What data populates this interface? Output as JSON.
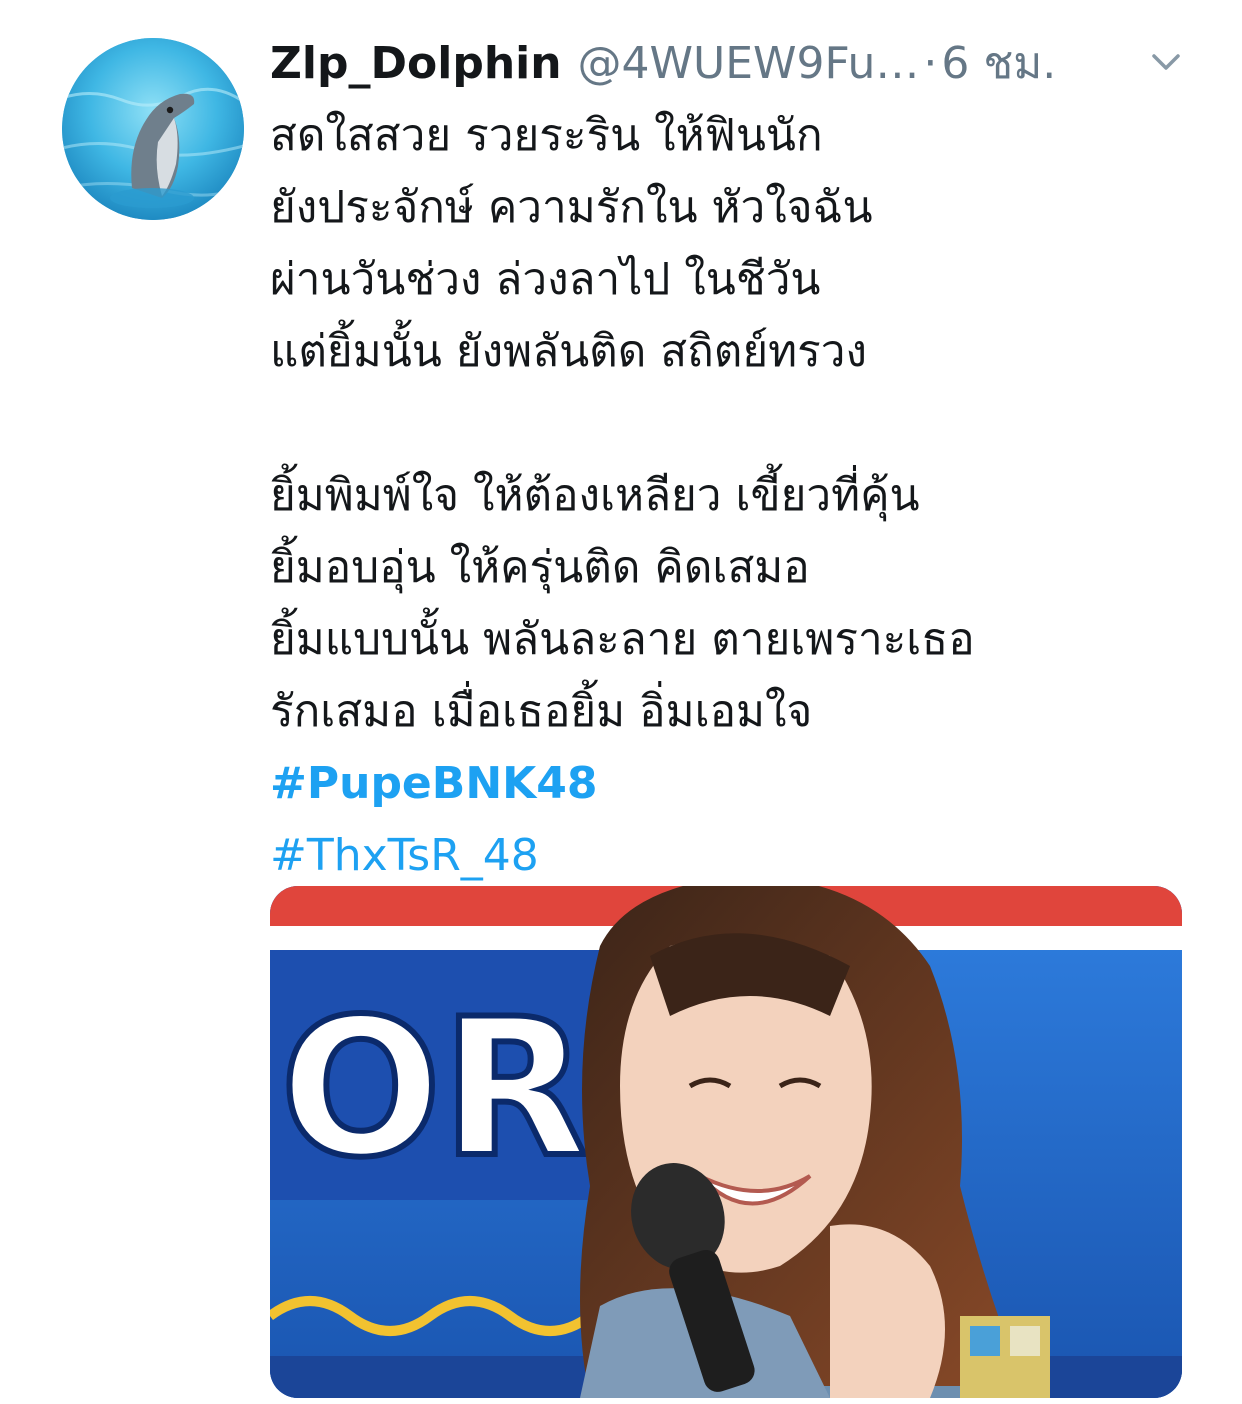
{
  "tweet": {
    "display_name": "Zlp_Dolphin",
    "handle": "@4WUEW9Fu…",
    "separator": "·",
    "time": "6 ชม.",
    "avatar_icon": "dolphin-avatar",
    "menu_icon": "chevron-down-icon",
    "lines": [
      "สดใสสวย รวยระริน ให้ฟินนัก",
      "ยังประจักษ์ ความรักใน หัวใจฉัน",
      "ผ่านวันช่วง ล่วงลาไป ในชีวัน",
      "แต่ยิ้มนั้น ยังพลันติด สถิตย์ทรวง",
      "ยิ้มพิมพ์ใจ ให้ต้องเหลียว เขี้ยวที่คุ้น",
      "ยิ้มอบอุ่น ให้ครุ่นติด คิดเสมอ",
      "ยิ้มแบบนั้น พลันละลาย ตายเพราะเธอ",
      "รักเสมอ เมื่อเธอยิ้ม อิ่มเอมใจ"
    ],
    "hashtags": [
      "#PupeBNK48",
      "#ThxTsR_48"
    ],
    "media": {
      "banner_text": "OR YO",
      "colors": {
        "link": "#1da1f2",
        "muted": "#657786"
      }
    }
  }
}
